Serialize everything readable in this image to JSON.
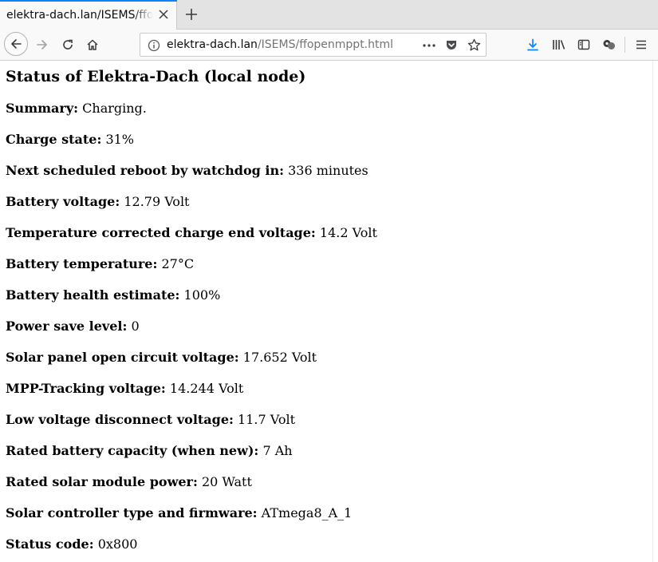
{
  "browser": {
    "tab": {
      "title": "elektra-dach.lan/ISEMS/ffopenmppt.html"
    },
    "url": {
      "host": "elektra-dach.lan",
      "path": "/ISEMS/ffopenmppt.html"
    },
    "icons": [
      "back-arrow-icon",
      "forward-arrow-icon",
      "reload-icon",
      "home-icon",
      "info-icon",
      "more-dots-icon",
      "pocket-icon",
      "bookmark-star-icon",
      "download-icon",
      "library-icon",
      "sidebar-icon",
      "extension-icon",
      "hamburger-menu-icon",
      "close-icon",
      "plus-icon"
    ],
    "accent_color": "#0a84ff"
  },
  "page": {
    "title": "Status of Elektra-Dach (local node)",
    "rows": [
      {
        "label": "Summary:",
        "value": "Charging."
      },
      {
        "label": "Charge state:",
        "value": "31%"
      },
      {
        "label": "Next scheduled reboot by watchdog in:",
        "value": "336 minutes"
      },
      {
        "label": "Battery voltage:",
        "value": "12.79 Volt"
      },
      {
        "label": "Temperature corrected charge end voltage:",
        "value": "14.2 Volt"
      },
      {
        "label": "Battery temperature:",
        "value": "27°C"
      },
      {
        "label": "Battery health estimate:",
        "value": "100%"
      },
      {
        "label": "Power save level:",
        "value": "0"
      },
      {
        "label": "Solar panel open circuit voltage:",
        "value": "17.652 Volt"
      },
      {
        "label": "MPP-Tracking voltage:",
        "value": "14.244 Volt"
      },
      {
        "label": "Low voltage disconnect voltage:",
        "value": "11.7 Volt"
      },
      {
        "label": "Rated battery capacity (when new):",
        "value": "7 Ah"
      },
      {
        "label": "Rated solar module power:",
        "value": "20 Watt"
      },
      {
        "label": "Solar controller type and firmware:",
        "value": "ATmega8_A_1"
      },
      {
        "label": "Status code:",
        "value": "0x800"
      }
    ]
  }
}
